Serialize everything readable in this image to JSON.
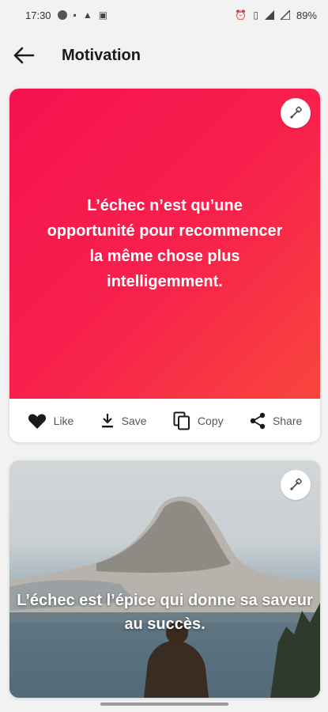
{
  "status": {
    "time": "17:30",
    "battery": "89%"
  },
  "app_bar": {
    "title": "Motivation"
  },
  "quotes": [
    {
      "text": "L’échec n’est qu’une opportunité pour recommencer la même chose plus intelligemment."
    },
    {
      "text": "L’échec est l’épice qui donne sa saveur au succès."
    }
  ],
  "actions": {
    "like": "Like",
    "save": "Save",
    "copy": "Copy",
    "share": "Share"
  },
  "colors": {
    "card_gradient_start": "#f5124f",
    "card_gradient_end": "#f8463d"
  }
}
